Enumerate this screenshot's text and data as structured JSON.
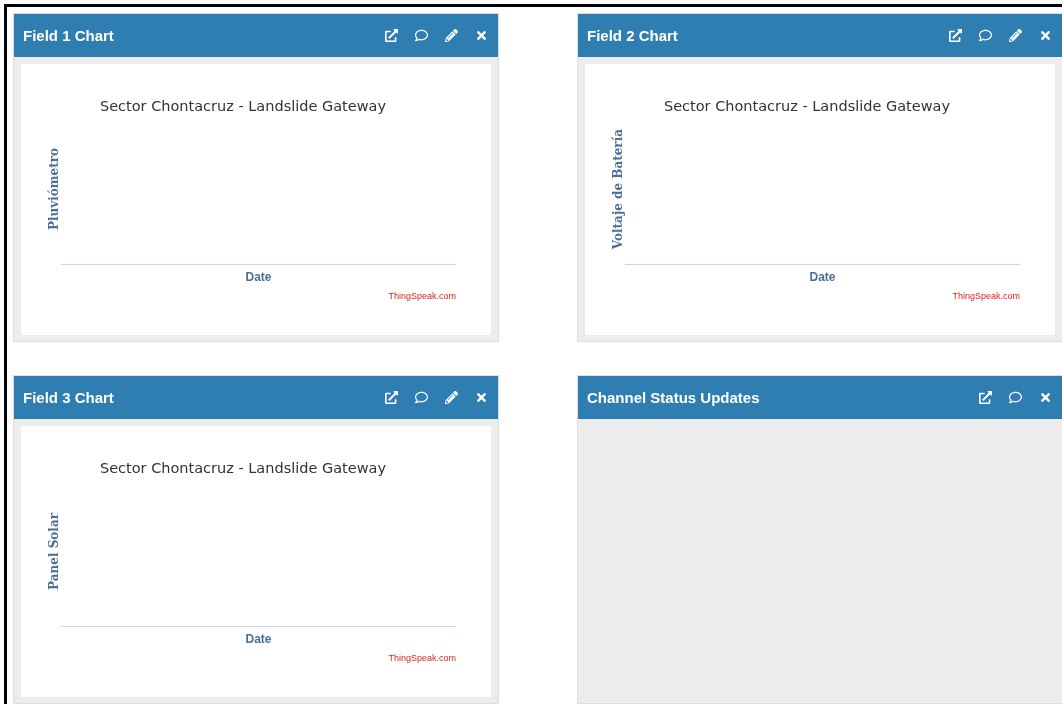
{
  "panels": [
    {
      "title": "Field 1 Chart",
      "kind": "chart",
      "editable": true,
      "chart": {
        "title": "Sector Chontacruz - Landslide Gateway",
        "ylabel": "Pluviómetro",
        "xlabel": "Date",
        "credits": "ThingSpeak.com"
      }
    },
    {
      "title": "Field 2 Chart",
      "kind": "chart",
      "editable": true,
      "chart": {
        "title": "Sector Chontacruz - Landslide Gateway",
        "ylabel": "Voltaje de Batería",
        "xlabel": "Date",
        "credits": "ThingSpeak.com"
      }
    },
    {
      "title": "Field 3 Chart",
      "kind": "chart",
      "editable": true,
      "chart": {
        "title": "Sector Chontacruz - Landslide Gateway",
        "ylabel": "Panel Solar",
        "xlabel": "Date",
        "credits": "ThingSpeak.com"
      }
    },
    {
      "title": "Channel Status Updates",
      "kind": "status",
      "editable": false
    }
  ]
}
